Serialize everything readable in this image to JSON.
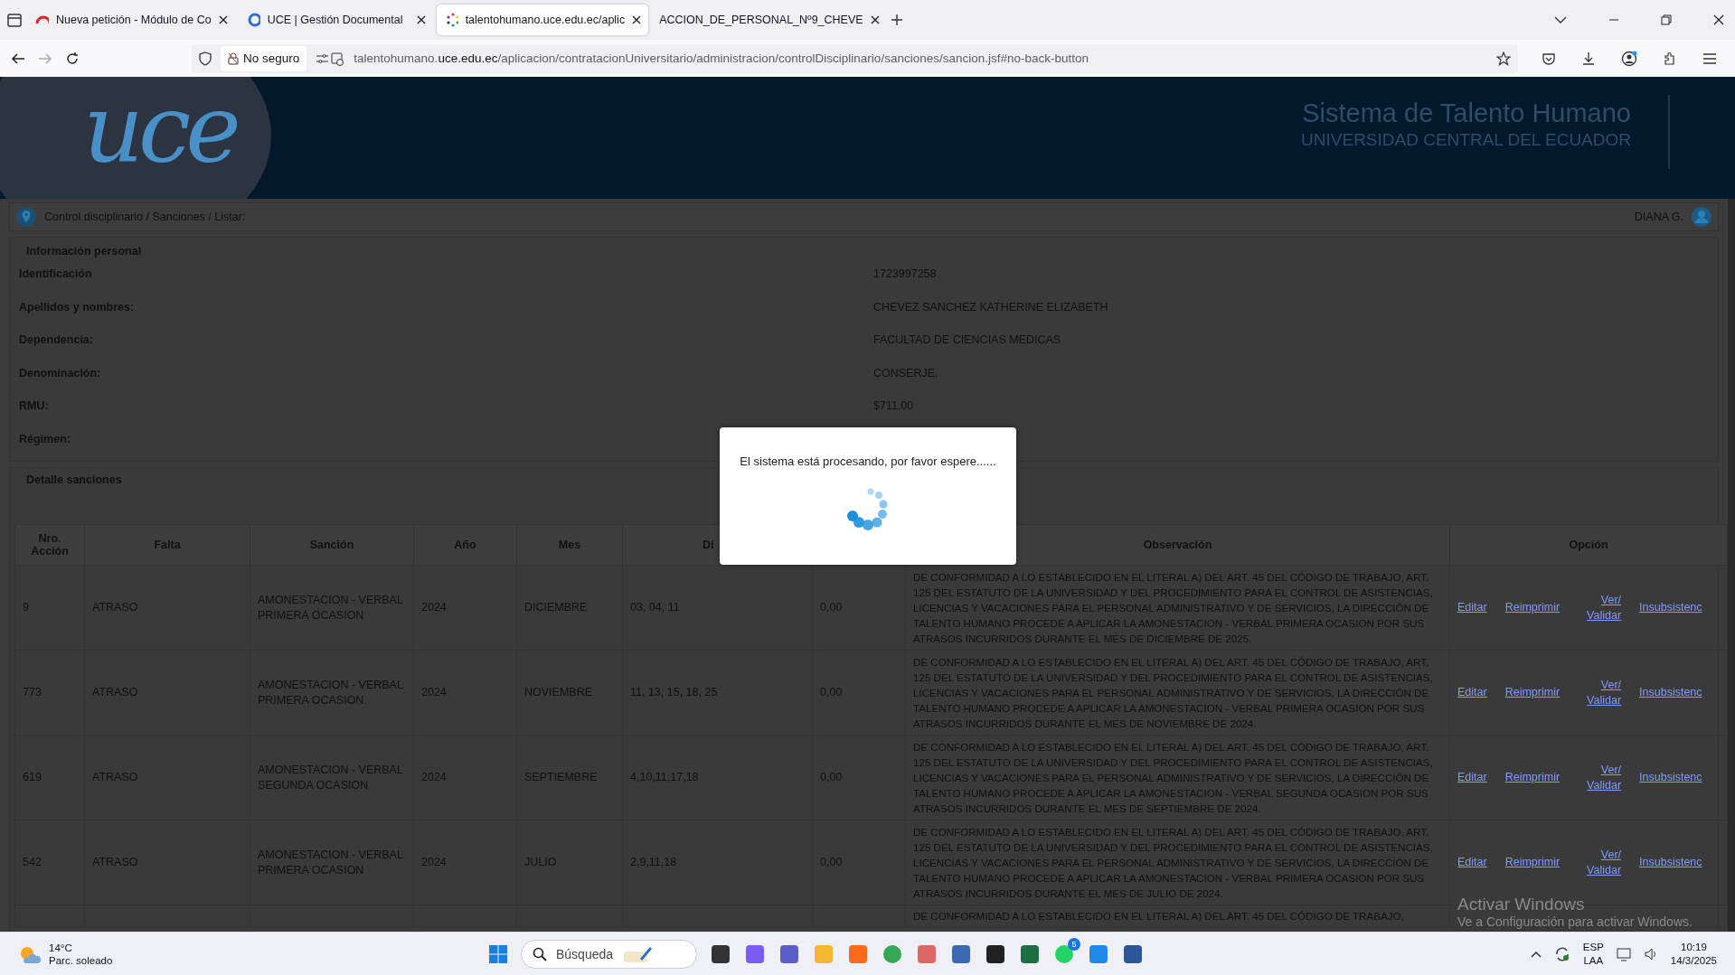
{
  "browser": {
    "tabs": [
      {
        "title": "Nueva petición - Módulo de Co",
        "selected": false
      },
      {
        "title": "UCE | Gestión Documental",
        "selected": false
      },
      {
        "title": "talentohumano.uce.edu.ec/aplic",
        "selected": true
      },
      {
        "title": "ACCION_DE_PERSONAL_Nº9_CHEVE",
        "selected": false
      }
    ],
    "security_label": "No seguro",
    "url_prefix": "talentohumano.",
    "url_domain": "uce.edu.ec",
    "url_path": "/aplicacion/contratacionUniversitario/administracion/controlDisciplinario/sanciones/sancion.jsf#no-back-button"
  },
  "header": {
    "logo": "uce",
    "title": "Sistema de Talento Humano",
    "subtitle": "UNIVERSIDAD CENTRAL DEL ECUADOR"
  },
  "breadcrumb": "Control disciplinario / Sanciones / Listar:",
  "user": "DIANA G.",
  "personal_info": {
    "title": "Información personal",
    "fields": [
      {
        "label": "Identificación",
        "value": "1723997258"
      },
      {
        "label": "Apellidos y nombres:",
        "value": "CHEVEZ SANCHEZ KATHERINE ELIZABETH"
      },
      {
        "label": "Dependencia:",
        "value": "FACULTAD DE CIENCIAS MEDICAS"
      },
      {
        "label": "Denominación:",
        "value": "CONSERJE."
      },
      {
        "label": "RMU:",
        "value": "$711,00"
      },
      {
        "label": "Régimen:"
      }
    ]
  },
  "sanctions": {
    "title": "Detalle sanciones",
    "columns": [
      "Nro. Acción",
      "Falta",
      "Sanción",
      "Año",
      "Mes",
      "Dí",
      "",
      "Observación",
      "Opción"
    ],
    "rows": [
      {
        "nro": "9",
        "falta": "ATRASO",
        "sancion": "AMONESTACION - VERBAL PRIMERA OCASION",
        "anio": "2024",
        "mes": "DICIEMBRE",
        "dias": "03, 04, 11",
        "column_7": "0,00",
        "observacion": "DE CONFORMIDAD A LO ESTABLECIDO EN EL LITERAL A) DEL ART. 45 DEL CÓDIGO DE TRABAJO, ART. 125 DEL ESTATUTO DE LA UNIVERSIDAD Y DEL PROCEDIMIENTO PARA EL CONTROL DE ASISTENCIAS, LICENCIAS Y VACACIONES PARA EL PERSONAL ADMINISTRATIVO Y DE SERVICIOS, LA DIRECCIÓN DE TALENTO HUMANO PROCEDE A APLICAR LA AMONESTACION - VERBAL PRIMERA OCASION POR SUS ATRASOS INCURRIDOS DURANTE EL MES DE DICIEMBRE DE 2025.",
        "options": [
          "Editar",
          "Reimprimir",
          "Ver/ Validar",
          "Insubsistenc"
        ]
      },
      {
        "nro": "773",
        "falta": "ATRASO",
        "sancion": "AMONESTACION - VERBAL PRIMERA OCASION",
        "anio": "2024",
        "mes": "NOVIEMBRE",
        "dias": "11, 13, 15, 18, 25",
        "column_7": "0,00",
        "observacion": "DE CONFORMIDAD A LO ESTABLECIDO EN EL LITERAL A) DEL ART. 45 DEL CÓDIGO DE TRABAJO, ART. 125 DEL ESTATUTO DE LA UNIVERSIDAD Y DEL PROCEDIMIENTO PARA EL CONTROL DE ASISTENCIAS, LICENCIAS Y VACACIONES PARA EL PERSONAL ADMINISTRATIVO Y DE SERVICIOS, LA DIRECCIÓN DE TALENTO HUMANO PROCEDE A APLICAR LA AMONESTACION - VERBAL PRIMERA OCASION POR SUS ATRASOS INCURRIDOS DURANTE EL MES DE NOVIEMBRE DE 2024.",
        "options": [
          "Editar",
          "Reimprimir",
          "Ver/ Validar",
          "Insubsistenc"
        ]
      },
      {
        "nro": "619",
        "falta": "ATRASO",
        "sancion": "AMONESTACION - VERBAL SEGUNDA OCASION",
        "anio": "2024",
        "mes": "SEPTIEMBRE",
        "dias": "4,10,11,17,18",
        "column_7": "0,00",
        "observacion": "DE CONFORMIDAD A LO ESTABLECIDO EN EL LITERAL A) DEL ART. 45 DEL CÓDIGO DE TRABAJO, ART. 125 DEL ESTATUTO DE LA UNIVERSIDAD Y DEL PROCEDIMIENTO PARA EL CONTROL DE ASISTENCIAS, LICENCIAS Y VACACIONES PARA EL PERSONAL ADMINISTRATIVO Y DE SERVICIOS, LA DIRECCIÓN DE TALENTO HUMANO PROCEDE A APLICAR LA AMONESTACION - VERBAL SEGUNDA OCASION POR SUS ATRASOS INCURRIDOS DURANTE EL MES DE SEPTIEMBRE DE 2024.",
        "options": [
          "Editar",
          "Reimprimir",
          "Ver/ Validar",
          "Insubsistenc"
        ]
      },
      {
        "nro": "542",
        "falta": "ATRASO",
        "sancion": "AMONESTACION - VERBAL PRIMERA OCASION",
        "anio": "2024",
        "mes": "JULIO",
        "dias": "2,9,11,18",
        "column_7": "0,00",
        "observacion": "DE CONFORMIDAD A LO ESTABLECIDO EN EL LITERAL A) DEL ART. 45 DEL CÓDIGO DE TRABAJO, ART. 125 DEL ESTATUTO DE LA UNIVERSIDAD Y DEL PROCEDIMIENTO PARA EL CONTROL DE ASISTENCIAS, LICENCIAS Y VACACIONES PARA EL PERSONAL ADMINISTRATIVO Y DE SERVICIOS, LA DIRECCIÓN DE TALENTO HUMANO PROCEDE A APLICAR LA AMONESTACION - VERBAL PRIMERA OCASION POR SUS ATRASOS INCURRIDOS DURANTE EL MES DE JULIO DE 2024.",
        "options": [
          "Editar",
          "Reimprimir",
          "Ver/ Validar",
          "Insubsistenc"
        ]
      },
      {
        "observacion": "DE CONFORMIDAD A LO ESTABLECIDO EN EL LITERAL A) DEL ART. 45 DEL CÓDIGO DE TRABAJO,"
      }
    ]
  },
  "dialog": {
    "message": "El sistema está procesando, por favor espere......"
  },
  "windows_notice": {
    "title": "Activar Windows",
    "text": "Ve a Configuración para activar Windows."
  },
  "taskbar": {
    "temperature": "14°C",
    "weather": "Parc. soleado",
    "search_placeholder": "Búsqueda",
    "whatsapp_badge": "5",
    "language": "ESP",
    "layout": "LAA",
    "time": "10:19",
    "date": "14/3/2025"
  }
}
